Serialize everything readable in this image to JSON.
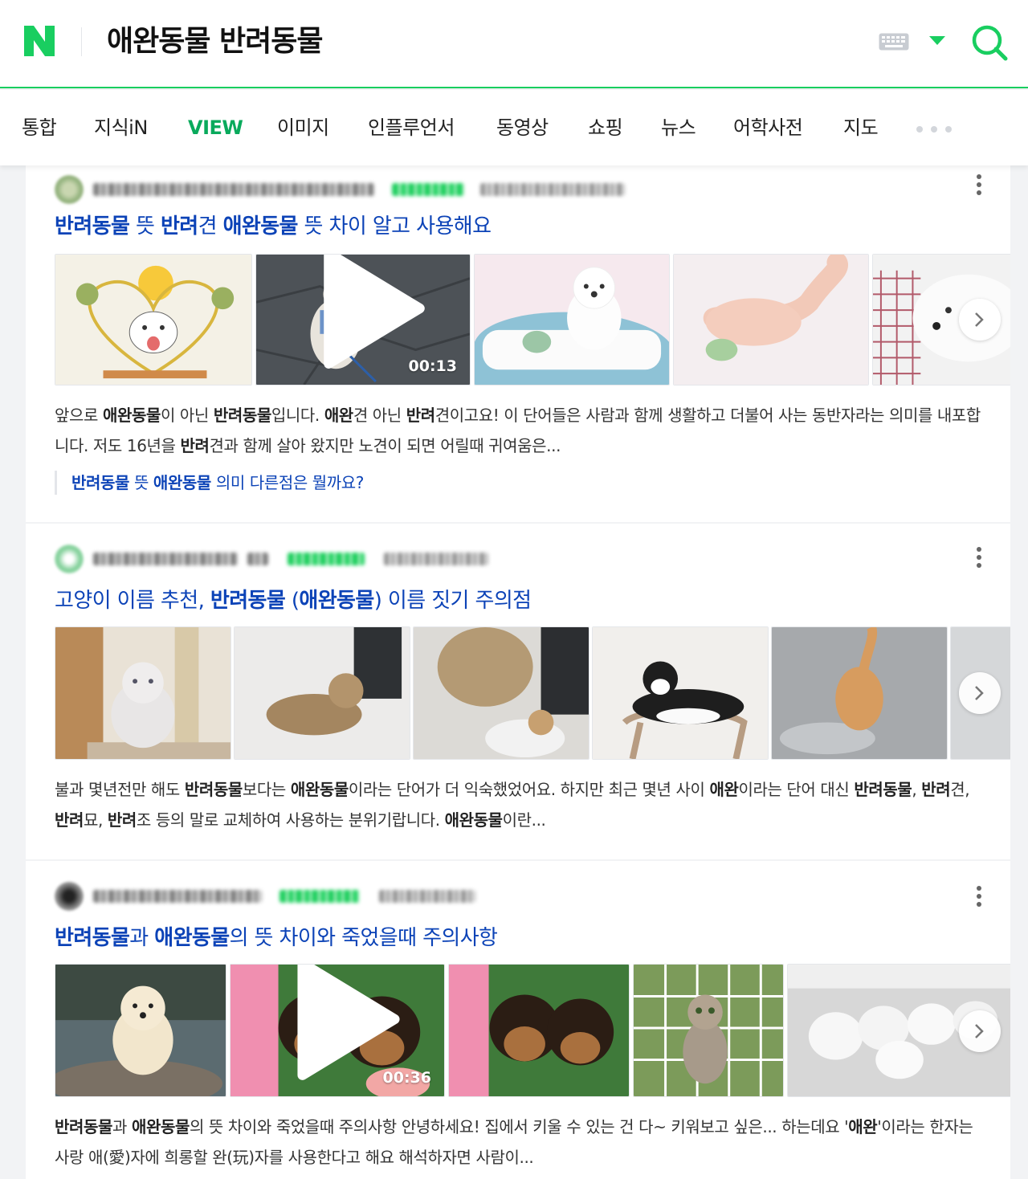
{
  "header": {
    "logo_letter": "N",
    "query": "애완동물 반려동물",
    "icons": [
      "keyboard-icon",
      "chevron-down-icon",
      "search-icon"
    ],
    "brand_color": "#19ce60",
    "link_color": "#0c43b7"
  },
  "tabs": [
    "통합",
    "지식iN",
    "VIEW",
    "이미지",
    "인플루언서",
    "동영상",
    "쇼핑",
    "뉴스",
    "어학사전",
    "지도"
  ],
  "active_tab": "VIEW",
  "results": [
    {
      "title_parts": [
        {
          "t": "반려동물",
          "b": true
        },
        {
          "t": " 뜻 ",
          "b": false
        },
        {
          "t": "반려",
          "b": true
        },
        {
          "t": "견 ",
          "b": false
        },
        {
          "t": "애완동물",
          "b": true
        },
        {
          "t": " 뜻 차이 알고 사용해요",
          "b": false
        }
      ],
      "video_duration": "00:13",
      "desc_parts": [
        {
          "t": "앞으로 ",
          "b": false
        },
        {
          "t": "애완동물",
          "b": true
        },
        {
          "t": "이 아닌 ",
          "b": false
        },
        {
          "t": "반려동물",
          "b": true
        },
        {
          "t": "입니다. ",
          "b": false
        },
        {
          "t": "애완",
          "b": true
        },
        {
          "t": "견 아닌 ",
          "b": false
        },
        {
          "t": "반려",
          "b": true
        },
        {
          "t": "견이고요! 이 단어들은 사람과 함께 생활하고 더불어 사는 동반자라는 의미를 내포합니다. 저도 16년을 ",
          "b": false
        },
        {
          "t": "반려",
          "b": true
        },
        {
          "t": "견과 함께 살아 왔지만 노견이 되면 어릴때 귀여움은...",
          "b": false
        }
      ],
      "sub_link_parts": [
        {
          "t": "반려동물",
          "b": true
        },
        {
          "t": " 뜻 ",
          "b": false
        },
        {
          "t": "애완동물",
          "b": true
        },
        {
          "t": " 의미 다른점은 뭘까요?",
          "b": false
        }
      ]
    },
    {
      "title_parts": [
        {
          "t": "고양이 이름 추천, ",
          "b": false
        },
        {
          "t": "반려동물",
          "b": true
        },
        {
          "t": " (",
          "b": false
        },
        {
          "t": "애완동물",
          "b": true
        },
        {
          "t": ") 이름 짓기 주의점",
          "b": false
        }
      ],
      "desc_parts": [
        {
          "t": "불과 몇년전만 해도 ",
          "b": false
        },
        {
          "t": "반려동물",
          "b": true
        },
        {
          "t": "보다는 ",
          "b": false
        },
        {
          "t": "애완동물",
          "b": true
        },
        {
          "t": "이라는 단어가 더 익숙했었어요. 하지만 최근 몇년 사이 ",
          "b": false
        },
        {
          "t": "애완",
          "b": true
        },
        {
          "t": "이라는 단어 대신 ",
          "b": false
        },
        {
          "t": "반려동물",
          "b": true
        },
        {
          "t": ", ",
          "b": false
        },
        {
          "t": "반려",
          "b": true
        },
        {
          "t": "견, ",
          "b": false
        },
        {
          "t": "반려",
          "b": true
        },
        {
          "t": "묘, ",
          "b": false
        },
        {
          "t": "반려",
          "b": true
        },
        {
          "t": "조 등의 말로 교체하여 사용하는 분위기랍니다. ",
          "b": false
        },
        {
          "t": "애완동물",
          "b": true
        },
        {
          "t": "이란...",
          "b": false
        }
      ]
    },
    {
      "title_parts": [
        {
          "t": "반려동물",
          "b": true
        },
        {
          "t": "과 ",
          "b": false
        },
        {
          "t": "애완동물",
          "b": true
        },
        {
          "t": "의 뜻 차이와 죽었을때 주의사항",
          "b": false
        }
      ],
      "video_duration": "00:36",
      "desc_parts": [
        {
          "t": "반려동물",
          "b": true
        },
        {
          "t": "과 ",
          "b": false
        },
        {
          "t": "애완동물",
          "b": true
        },
        {
          "t": "의 뜻 차이와 죽었을때 주의사항 안녕하세요! 집에서 키울 수 있는 건 다~ 키워보고 싶은... 하는데요 '",
          "b": false
        },
        {
          "t": "애완",
          "b": true
        },
        {
          "t": "'이라는 한자는 사랑 애(愛)자에 희롱할 완(玩)자를 사용한다고 해요 해석하자면 사람이...",
          "b": false
        }
      ]
    }
  ]
}
